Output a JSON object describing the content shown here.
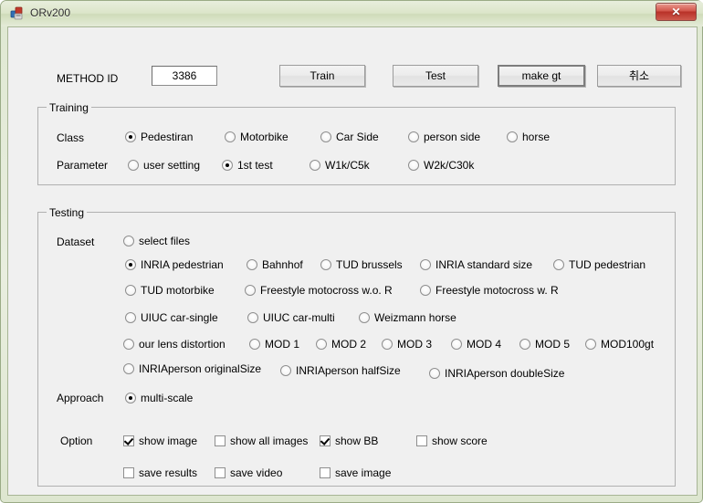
{
  "window": {
    "title": "ORv200",
    "icon": "app-icon",
    "close_label": "✕"
  },
  "toolbar": {
    "method_id_label": "METHOD ID",
    "method_id_value": "3386",
    "buttons": [
      {
        "name": "train",
        "label": "Train",
        "default": false
      },
      {
        "name": "test",
        "label": "Test",
        "default": false
      },
      {
        "name": "make-gt",
        "label": "make gt",
        "default": true
      },
      {
        "name": "cancel",
        "label": "취소",
        "default": false
      }
    ]
  },
  "training": {
    "title": "Training",
    "class_label": "Class",
    "class_options": [
      {
        "label": "Pedestiran",
        "checked": true
      },
      {
        "label": "Motorbike",
        "checked": false
      },
      {
        "label": "Car Side",
        "checked": false
      },
      {
        "label": "person side",
        "checked": false
      },
      {
        "label": "horse",
        "checked": false
      }
    ],
    "parameter_label": "Parameter",
    "parameter_options": [
      {
        "label": "user setting",
        "checked": false
      },
      {
        "label": "1st test",
        "checked": true
      },
      {
        "label": "W1k/C5k",
        "checked": false
      },
      {
        "label": "W2k/C30k",
        "checked": false
      }
    ]
  },
  "testing": {
    "title": "Testing",
    "dataset_label": "Dataset",
    "dataset_options": [
      {
        "label": "select files",
        "checked": false
      },
      {
        "label": "INRIA pedestrian",
        "checked": true
      },
      {
        "label": "Bahnhof",
        "checked": false
      },
      {
        "label": "TUD brussels",
        "checked": false
      },
      {
        "label": "INRIA standard size",
        "checked": false
      },
      {
        "label": "TUD pedestrian",
        "checked": false
      },
      {
        "label": "TUD motorbike",
        "checked": false
      },
      {
        "label": "Freestyle motocross w.o. R",
        "checked": false
      },
      {
        "label": "Freestyle motocross w. R",
        "checked": false
      },
      {
        "label": "UIUC car-single",
        "checked": false
      },
      {
        "label": "UIUC car-multi",
        "checked": false
      },
      {
        "label": "Weizmann horse",
        "checked": false
      },
      {
        "label": "our lens distortion",
        "checked": false
      },
      {
        "label": "MOD 1",
        "checked": false
      },
      {
        "label": "MOD 2",
        "checked": false
      },
      {
        "label": "MOD 3",
        "checked": false
      },
      {
        "label": "MOD 4",
        "checked": false
      },
      {
        "label": "MOD 5",
        "checked": false
      },
      {
        "label": "MOD100gt",
        "checked": false
      },
      {
        "label": "INRIAperson originalSize",
        "checked": false
      },
      {
        "label": "INRIAperson halfSize",
        "checked": false
      },
      {
        "label": "INRIAperson doubleSize",
        "checked": false
      }
    ],
    "approach_label": "Approach",
    "approach_options": [
      {
        "label": "multi-scale",
        "checked": true
      }
    ],
    "option_label": "Option",
    "option_checkboxes": [
      {
        "label": "show image",
        "checked": true
      },
      {
        "label": "show all images",
        "checked": false
      },
      {
        "label": "show BB",
        "checked": true
      },
      {
        "label": "show score",
        "checked": false
      },
      {
        "label": "save results",
        "checked": false
      },
      {
        "label": "save video",
        "checked": false
      },
      {
        "label": "save image",
        "checked": false
      }
    ]
  },
  "colors": {
    "title_bar": "#dbe5c9",
    "client_bg": "#f0f0f0",
    "close_button": "#c0392b",
    "frame_border": "#9aab86"
  }
}
